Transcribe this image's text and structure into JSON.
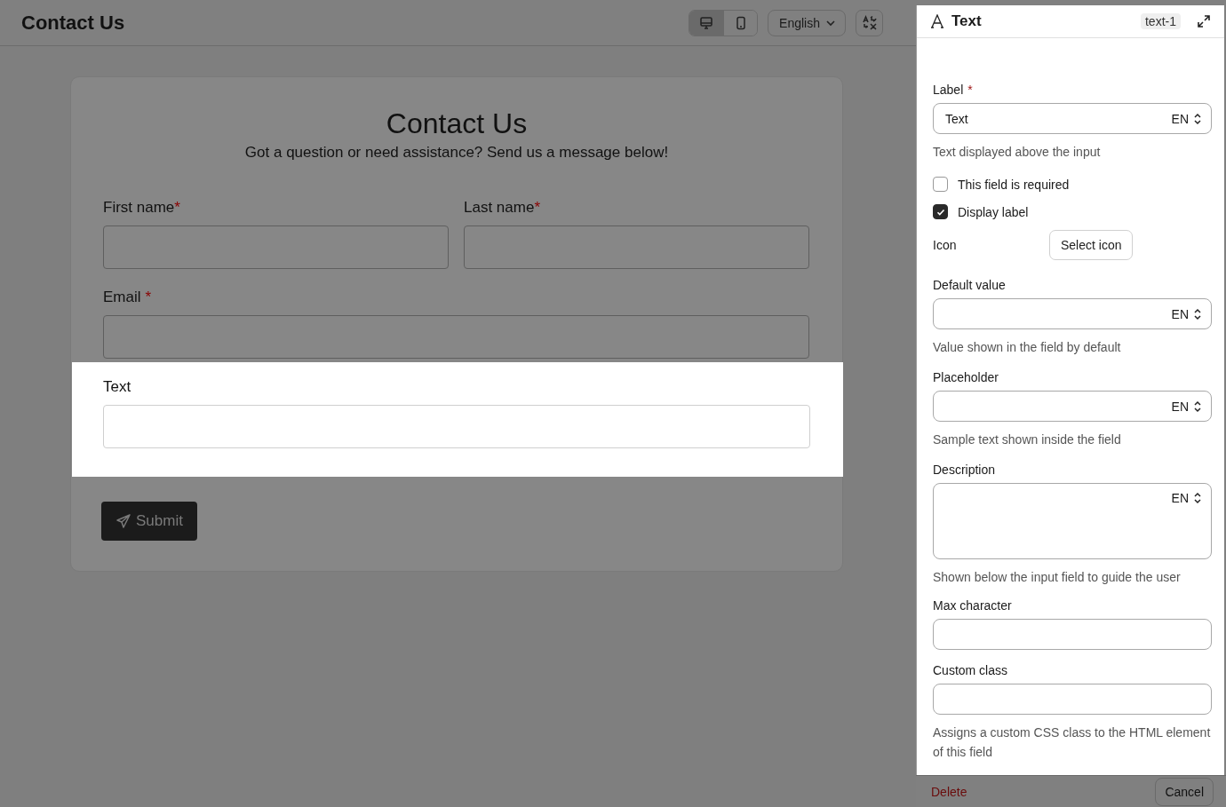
{
  "header": {
    "title": "Contact Us",
    "views": [
      {
        "kind": "desktop",
        "selected": true
      },
      {
        "kind": "mobile",
        "selected": false
      }
    ],
    "language": "English"
  },
  "form": {
    "title": "Contact Us",
    "subtitle": "Got a question or need assistance? Send us a message below!",
    "rows": [
      [
        {
          "label": "First name",
          "required": true,
          "highlighted": false
        },
        {
          "label": "Last name",
          "required": true,
          "highlighted": false
        }
      ],
      [
        {
          "label": "Email",
          "required": true,
          "highlighted": false
        }
      ],
      [
        {
          "label": "Text",
          "required": false,
          "highlighted": true
        }
      ]
    ],
    "required_mark": "*",
    "submit": "Submit"
  },
  "panel": {
    "title": "Text",
    "badge": "text-1",
    "required_mark": "*",
    "items": [
      {
        "kind": "input",
        "label": "Label",
        "required": true,
        "value": "Text",
        "lang": "EN",
        "help": "Text displayed above the input"
      },
      {
        "kind": "checkbox",
        "label": "This field is required",
        "checked": false
      },
      {
        "kind": "checkbox",
        "label": "Display label",
        "checked": true
      },
      {
        "kind": "icon",
        "label": "Icon",
        "button": "Select icon"
      },
      {
        "kind": "input",
        "label": "Default value",
        "required": false,
        "lang": "EN",
        "help": "Value shown in the field by default"
      },
      {
        "kind": "input",
        "label": "Placeholder",
        "required": false,
        "lang": "EN",
        "help": "Sample text shown inside the field"
      },
      {
        "kind": "textarea",
        "label": "Description",
        "required": false,
        "lang": "EN",
        "help": "Shown below the input field to guide the user"
      },
      {
        "kind": "input",
        "label": "Max character",
        "required": false
      },
      {
        "kind": "input",
        "label": "Custom class",
        "required": false,
        "help": "Assigns a custom CSS class to the HTML element of this field"
      }
    ],
    "delete": "Delete",
    "cancel": "Cancel"
  }
}
